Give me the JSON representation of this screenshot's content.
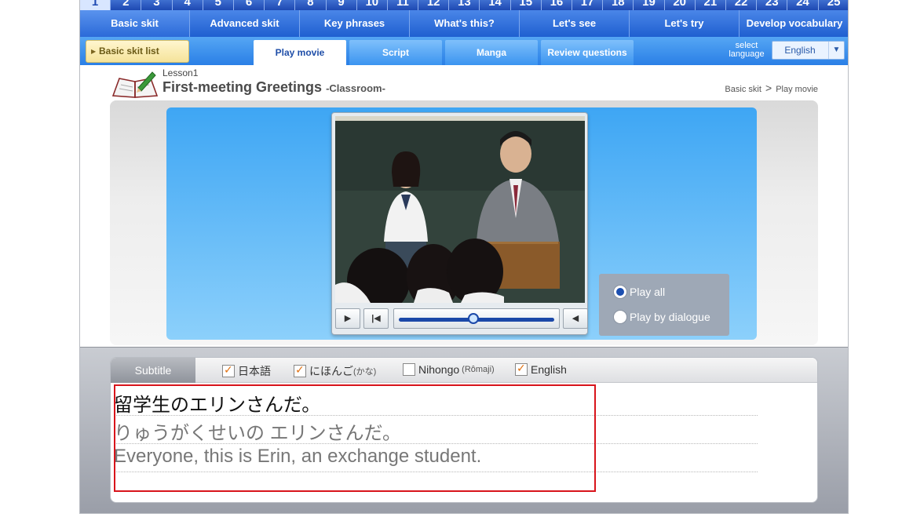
{
  "lesson_numbers": [
    "1",
    "2",
    "3",
    "4",
    "5",
    "6",
    "7",
    "8",
    "9",
    "10",
    "11",
    "12",
    "13",
    "14",
    "15",
    "16",
    "17",
    "18",
    "19",
    "20",
    "21",
    "22",
    "23",
    "24",
    "25"
  ],
  "sections": [
    "Basic skit",
    "Advanced skit",
    "Key phrases",
    "What's this?",
    "Let's see",
    "Let's try",
    "Develop vocabulary"
  ],
  "subnav": {
    "list_button": "Basic skit list",
    "tabs": [
      "Play movie",
      "Script",
      "Manga",
      "Review questions"
    ],
    "language_label_1": "select",
    "language_label_2": "language",
    "language_value": "English"
  },
  "header": {
    "lesson_label": "Lesson1",
    "title": "First-meeting Greetings",
    "subtitle": "-Classroom-",
    "breadcrumb_1": "Basic skit",
    "breadcrumb_sep": ">",
    "breadcrumb_2": "Play movie"
  },
  "player": {
    "progress": 0.48,
    "options": [
      "Play all",
      "Play by dialogue"
    ],
    "selected_option": "Play all"
  },
  "subtitle_panel": {
    "tab_label": "Subtitle",
    "checkboxes": [
      {
        "label": "日本語",
        "note": "",
        "checked": true
      },
      {
        "label": "にほんご",
        "note": "(かな)",
        "checked": true
      },
      {
        "label": "Nihongo",
        "note": "(Rômaji)",
        "checked": false
      },
      {
        "label": "English",
        "note": "",
        "checked": true
      }
    ],
    "lines": [
      "留学生のエリンさんだ。",
      "りゅうがくせいの エリンさんだ。",
      "Everyone, this is Erin, an exchange student."
    ]
  },
  "colors": {
    "accent_blue": "#1f5fd0",
    "highlight_red": "#d8141b",
    "checkbox_orange": "#e07010"
  }
}
